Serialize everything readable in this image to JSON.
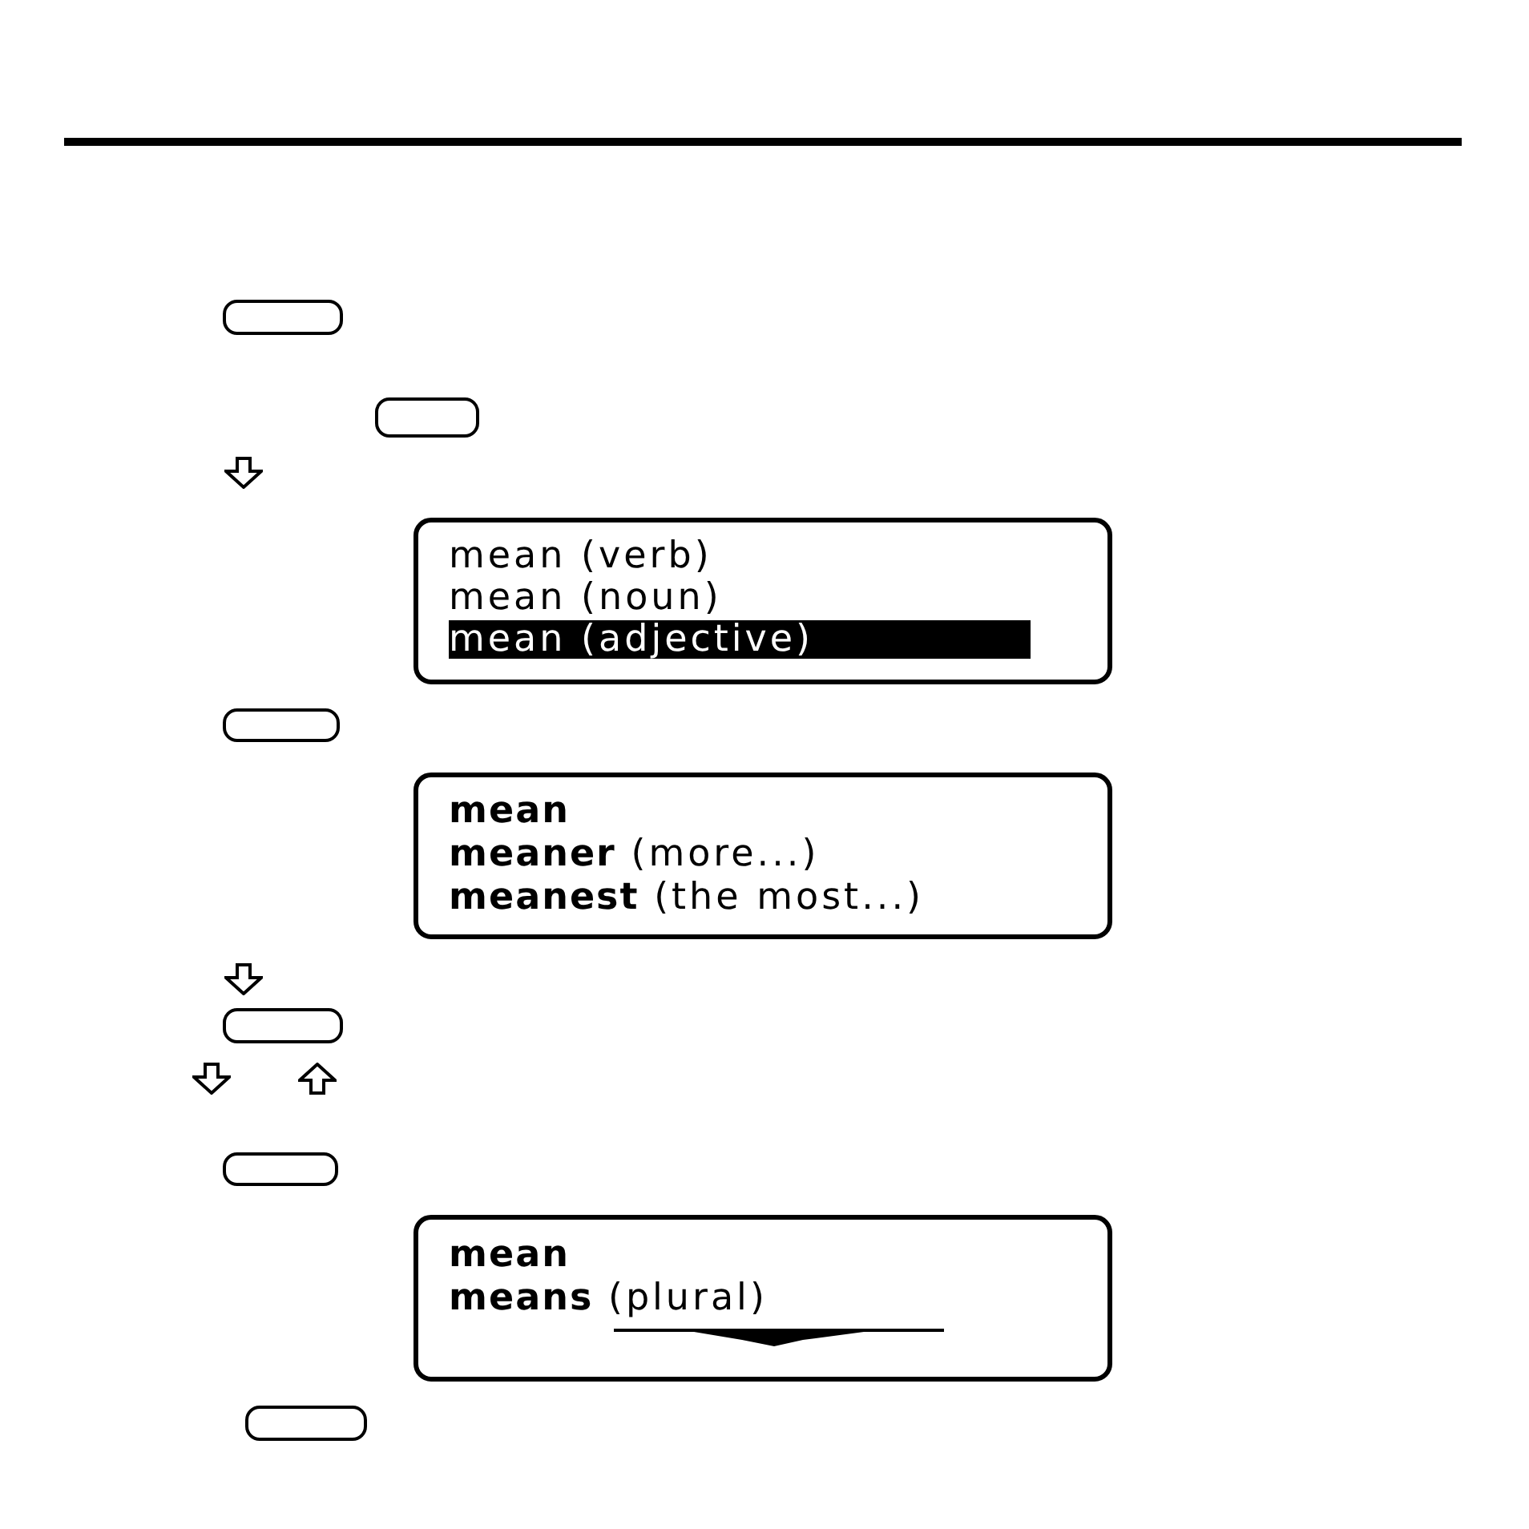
{
  "screens": [
    {
      "kind": "menu",
      "lines": [
        {
          "text": "mean (verb)",
          "selected": false
        },
        {
          "text": "mean (noun)",
          "selected": false
        },
        {
          "text": "mean (adjective)",
          "selected": true
        }
      ]
    },
    {
      "kind": "forms",
      "lines": [
        {
          "headword": "mean"
        },
        {
          "headword": "meaner",
          "note": "(more...)"
        },
        {
          "headword": "meanest",
          "note": "(the most...)"
        }
      ]
    },
    {
      "kind": "forms",
      "lines": [
        {
          "headword": "mean"
        },
        {
          "headword": "means",
          "note": "(plural)"
        }
      ],
      "more_below": true
    }
  ]
}
